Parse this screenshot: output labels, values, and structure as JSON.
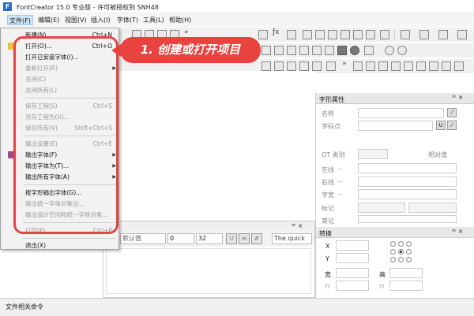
{
  "window": {
    "title": "FontCreator 15.0 专业版 - 许可被授权到 SNH48",
    "app_icon": "F"
  },
  "menubar": [
    "文件(F)",
    "编辑(E)",
    "视图(V)",
    "插入(I)",
    "字体(T)",
    "工具(L)",
    "帮助(H)"
  ],
  "file_menu": [
    {
      "label": "新建(N)",
      "shortcut": "Ctrl+N",
      "enabled": true
    },
    {
      "label": "打开(O)...",
      "shortcut": "Ctrl+O",
      "enabled": true
    },
    {
      "label": "打开已安装字体(I)...",
      "shortcut": "",
      "enabled": true
    },
    {
      "label": "重新打开(R)",
      "shortcut": "",
      "enabled": false,
      "submenu": true
    },
    {
      "label": "关闭(C)",
      "shortcut": "",
      "enabled": false
    },
    {
      "label": "关闭所有(L)",
      "shortcut": "",
      "enabled": false
    },
    {
      "label": "保存工程(S)",
      "shortcut": "Ctrl+S",
      "enabled": false
    },
    {
      "label": "另存工程为(U)...",
      "shortcut": "",
      "enabled": false
    },
    {
      "label": "保存所有(V)",
      "shortcut": "Shift+Ctrl+S",
      "enabled": false
    },
    {
      "label": "输出设置(E)",
      "shortcut": "Ctrl+E",
      "enabled": false
    },
    {
      "label": "输出字体(F)",
      "shortcut": "",
      "enabled": true,
      "submenu": true
    },
    {
      "label": "输出字体为(T)...",
      "shortcut": "",
      "enabled": true,
      "submenu": true
    },
    {
      "label": "输出所有字体(A)",
      "shortcut": "",
      "enabled": true,
      "submenu": true
    },
    {
      "label": "按字形输出字体(G)...",
      "shortcut": "",
      "enabled": true
    },
    {
      "label": "输出统一字体对象(J)...",
      "shortcut": "",
      "enabled": false
    },
    {
      "label": "输出设计空间和统一字体对象...",
      "shortcut": "",
      "enabled": false
    },
    {
      "label": "打印(P)...",
      "shortcut": "Ctrl+P",
      "enabled": false
    },
    {
      "label": "退出(X)",
      "shortcut": "",
      "enabled": true
    }
  ],
  "callout": {
    "text": "1. 创建或打开项目"
  },
  "glyph_properties": {
    "title": "字形属性",
    "pin": "ꟹ ×",
    "fields": {
      "name": "名称",
      "codepoints": "字码点",
      "ot_category": "OT 类别",
      "relative": "相对值",
      "left": "左线",
      "right": "右线",
      "width": "字宽",
      "mark": "标记",
      "note": "第记"
    },
    "dots": "--"
  },
  "transform": {
    "title": "转换",
    "pin": "ꟹ ×",
    "x": "X",
    "y": "Y",
    "width": "宽",
    "height": "高"
  },
  "preview_panel": {
    "pin": "ꟹ ×",
    "font_combo": "默认值",
    "size1": "0",
    "size2": "32",
    "sample_text": "The quick"
  },
  "statusbar": {
    "text": "文件相关命令"
  }
}
